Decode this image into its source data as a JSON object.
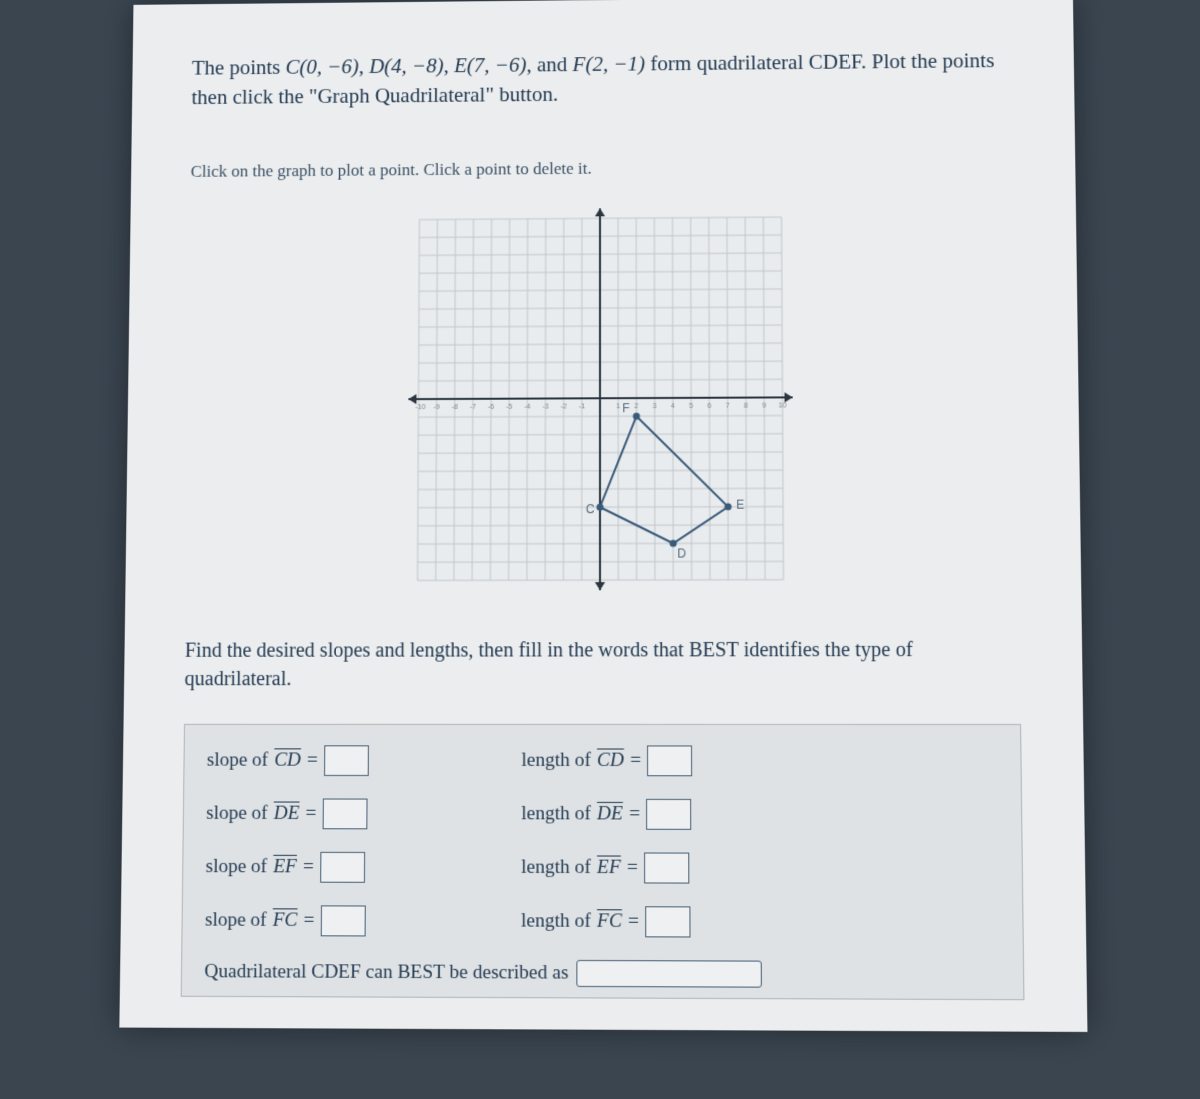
{
  "problem": {
    "prefix": "The points ",
    "C": "C(0, −6)",
    "D": "D(4, −8)",
    "E": "E(7, −6)",
    "F": "F(2, −1)",
    "middle": " form quadrilateral CDEF. Plot the points then click the \"Graph Quadrilateral\" button."
  },
  "instruction": "Click on the graph to plot a point. Click a point to delete it.",
  "afterGraph": "Find the desired slopes and lengths, then fill in the words that BEST identifies the type of quadrilateral.",
  "rows": [
    {
      "slopeLabel": "slope of ",
      "seg": "CD",
      "eq": " = ",
      "lenLabel": "length of ",
      "seg2": "CD",
      "eq2": " = "
    },
    {
      "slopeLabel": "slope of ",
      "seg": "DE",
      "eq": " = ",
      "lenLabel": "length of ",
      "seg2": "DE",
      "eq2": " = "
    },
    {
      "slopeLabel": "slope of ",
      "seg": "EF",
      "eq": " = ",
      "lenLabel": "length of ",
      "seg2": "EF",
      "eq2": " = "
    },
    {
      "slopeLabel": "slope of ",
      "seg": "FC",
      "eq": " = ",
      "lenLabel": "length of ",
      "seg2": "FC",
      "eq2": " = "
    }
  ],
  "conclusion": "Quadrilateral CDEF can BEST be described as",
  "graph": {
    "xmin": -10,
    "xmax": 10,
    "ymin": -10,
    "ymax": 10,
    "points": {
      "C": {
        "x": 0,
        "y": -6,
        "label": "C"
      },
      "D": {
        "x": 4,
        "y": -8,
        "label": "D"
      },
      "E": {
        "x": 7,
        "y": -6,
        "label": "E"
      },
      "F": {
        "x": 2,
        "y": -1,
        "label": "F"
      }
    }
  }
}
